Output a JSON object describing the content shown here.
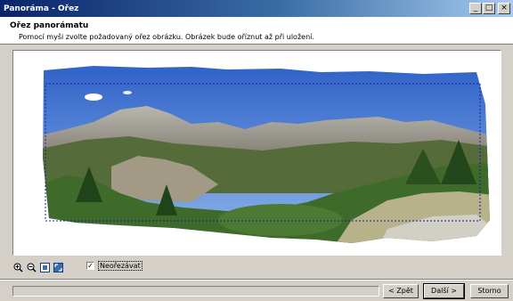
{
  "window": {
    "title": "Panoráma - Ořez"
  },
  "header": {
    "title": "Ořez panorámatu",
    "subtitle": "Pomocí myši zvolte požadovaný ořez obrázku. Obrázek bude oříznut až při uložení."
  },
  "title_buttons": {
    "minimize": "_",
    "maximize": "□",
    "close": "×"
  },
  "toolbar": {
    "icons": [
      "zoom-in-icon",
      "zoom-out-icon",
      "actual-size-icon",
      "fit-to-window-icon"
    ]
  },
  "crop_option": {
    "label": "Neořezávat",
    "checked": true,
    "check_mark": "✓"
  },
  "buttons": {
    "back": "< Zpět",
    "next": "Další >",
    "cancel": "Storno"
  },
  "colors": {
    "title_start": "#0a246a",
    "title_end": "#a6caf0",
    "sky": "#3b6fd0",
    "crop_line": "#1a1aa0"
  }
}
